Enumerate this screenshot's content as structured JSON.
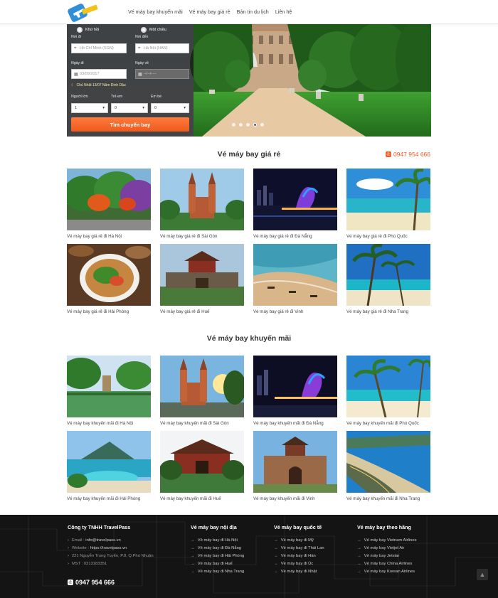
{
  "header": {
    "nav": [
      "Vé máy bay khuyến mãi",
      "Vé máy bay giá rẻ",
      "Bản tin du lịch",
      "Liên hệ"
    ]
  },
  "search": {
    "trip_one_way": "Khứ hồi",
    "trip_return": "Một chiều",
    "from_label": "Nơi đi",
    "from_value": "Hồ Chí Minh (SGN)",
    "to_label": "Nơi đến",
    "to_value": "Hà Nội (HAN)",
    "depart_label": "Ngày đi",
    "depart_value": "03/09/2017",
    "return_label": "Ngày về",
    "return_value": "--/--/----",
    "lunar_note": "Chủ Nhật 13/07 Năm Đinh Dậu",
    "adults_label": "Người lớn",
    "adults_value": "1",
    "children_label": "Trẻ em",
    "children_value": "0",
    "infants_label": "Em bé",
    "infants_value": "0",
    "submit_label": "Tìm chuyến bay"
  },
  "cheap": {
    "title": "Vé máy bay giá rẻ",
    "hotline": "0947 954 666",
    "items": [
      "Vé máy bay giá rẻ đi Hà Nội",
      "Vé máy bay giá rẻ đi Sài Gòn",
      "Vé máy bay giá rẻ đi Đà Nẵng",
      "Vé máy bay giá rẻ đi Phú Quốc",
      "Vé máy bay giá rẻ đi Hải Phòng",
      "Vé máy bay giá rẻ đi Huế",
      "Vé máy bay giá rẻ đi Vinh",
      "Vé máy bay giá rẻ đi Nha Trang"
    ]
  },
  "promo": {
    "title": "Vé máy bay khuyến mãi",
    "items": [
      "Vé máy bay khuyến mãi đi Hà Nội",
      "Vé máy bay khuyến mãi đi Sài Gòn",
      "Vé máy bay khuyến mãi đi Đà Nẵng",
      "Vé máy bay khuyến mãi đi Phú Quốc",
      "Vé máy bay khuyến mãi đi Hải Phòng",
      "Vé máy bay khuyến mãi đi Huế",
      "Vé máy bay khuyến mãi đi Vinh",
      "Vé máy bay khuyến mãi đi Nha Trang"
    ]
  },
  "footer": {
    "company": "Công ty TNHH TravelPass",
    "email_key": "Email :",
    "email": "info@travelpass.vn",
    "website_key": "Website :",
    "website": "https://travelpass.vn",
    "address": "221 Nguyễn Trọng Tuyển, P.8, Q.Phú Nhuận",
    "tax": "MST : 0313183351",
    "phone": "0947 954 666",
    "domestic_title": "Vé máy bay nội địa",
    "domestic": [
      "Vé máy bay đi Hà Nội",
      "Vé máy bay đi Đà Nẵng",
      "Vé máy bay đi Hải Phòng",
      "Vé máy bay đi Huế",
      "Vé máy bay đi Nha Trang"
    ],
    "intl_title": "Vé máy bay quốc tế",
    "intl": [
      "Vé máy bay đi Mỹ",
      "Vé máy bay đi Thái Lan",
      "Vé máy bay đi Hàn",
      "Vé máy bay đi Úc",
      "Vé máy bay đi Nhật"
    ],
    "airline_title": "Vé máy bay theo hãng",
    "airlines": [
      "Vé máy bay Vietnam Airlines",
      "Vé máy bay Vietjet Air",
      "Vé máy bay Jetstar",
      "Vé máy bay China Airlines",
      "Vé máy bay Korean Airlines"
    ]
  },
  "colors": {
    "accent": "#f15a22",
    "footer_bg": "#141414",
    "logo_blue": "#2f8fd8"
  }
}
